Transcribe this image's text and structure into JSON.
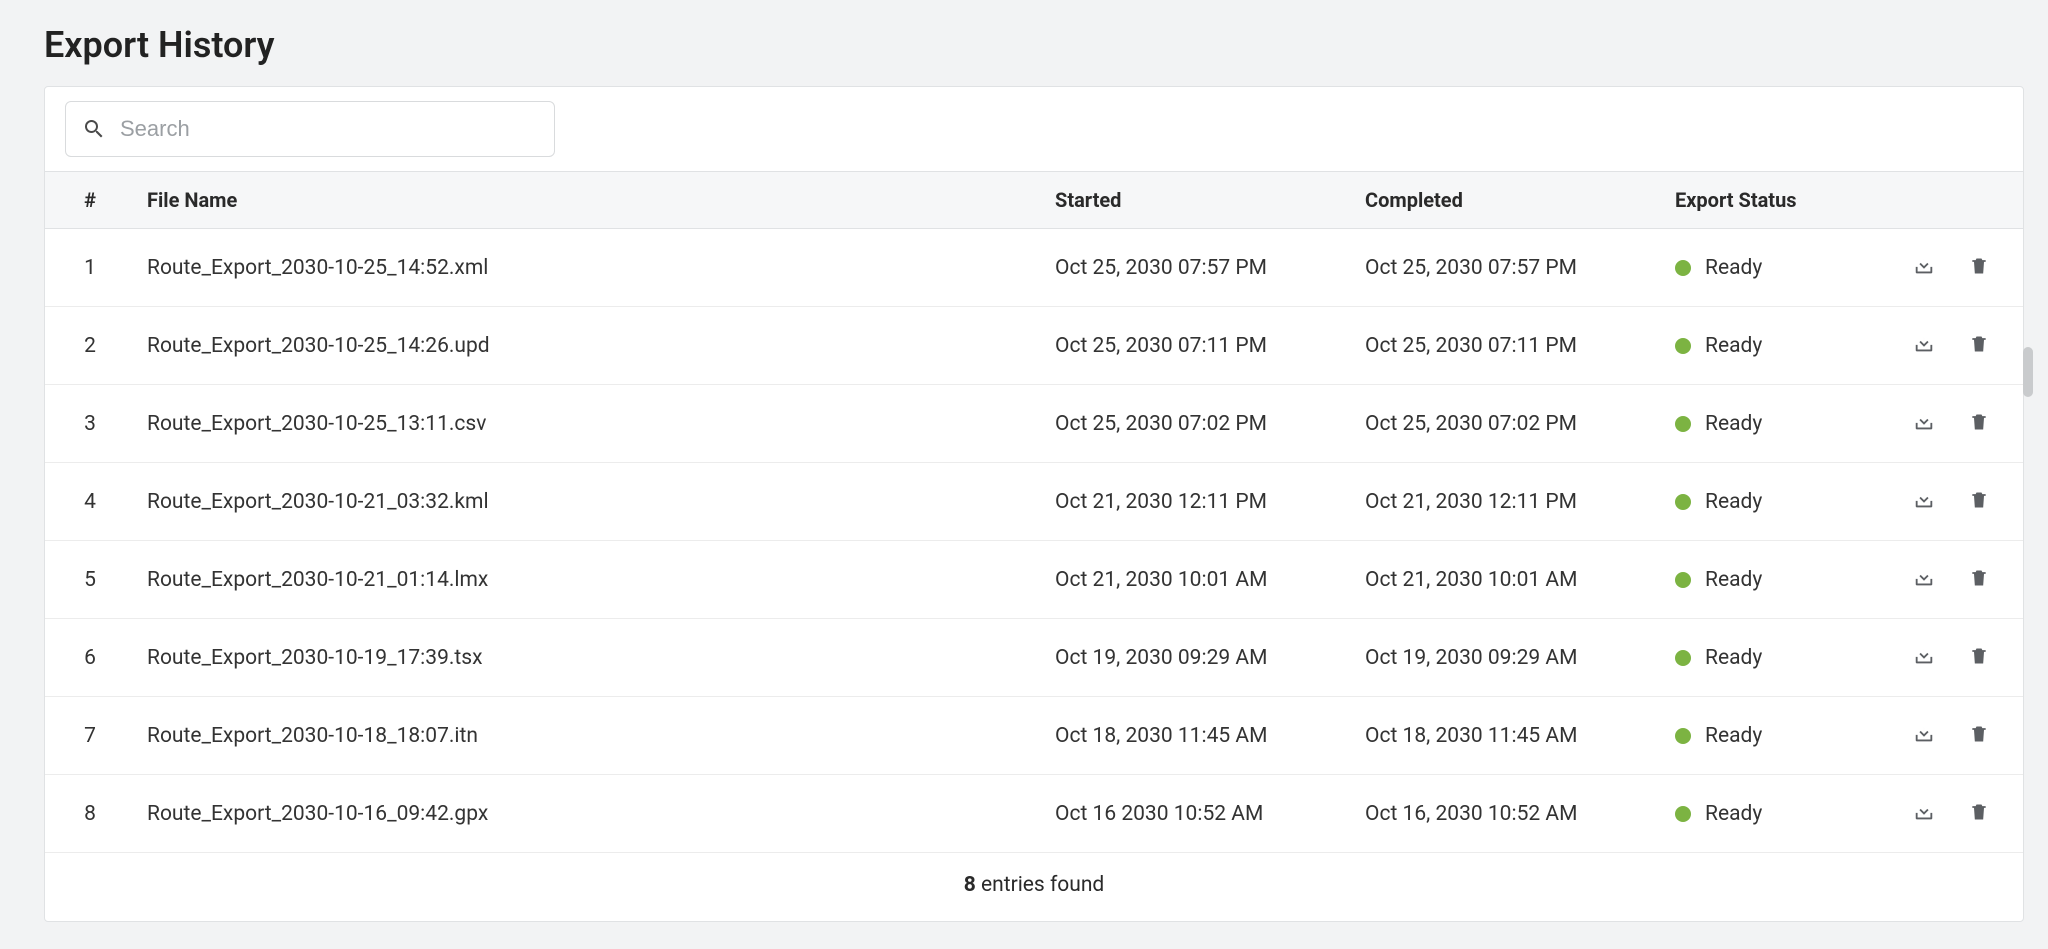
{
  "page": {
    "title": "Export History"
  },
  "search": {
    "placeholder": "Search"
  },
  "table": {
    "headers": {
      "num": "#",
      "file": "File Name",
      "started": "Started",
      "completed": "Completed",
      "status": "Export Status"
    },
    "rows": [
      {
        "num": "1",
        "file": "Route_Export_2030-10-25_14:52.xml",
        "started": "Oct 25, 2030 07:57 PM",
        "completed": "Oct 25, 2030 07:57 PM",
        "status": "Ready"
      },
      {
        "num": "2",
        "file": "Route_Export_2030-10-25_14:26.upd",
        "started": "Oct 25, 2030 07:11 PM",
        "completed": "Oct 25, 2030 07:11 PM",
        "status": "Ready"
      },
      {
        "num": "3",
        "file": "Route_Export_2030-10-25_13:11.csv",
        "started": "Oct 25, 2030 07:02 PM",
        "completed": "Oct 25, 2030 07:02 PM",
        "status": "Ready"
      },
      {
        "num": "4",
        "file": "Route_Export_2030-10-21_03:32.kml",
        "started": "Oct 21, 2030 12:11 PM",
        "completed": "Oct 21, 2030 12:11 PM",
        "status": "Ready"
      },
      {
        "num": "5",
        "file": "Route_Export_2030-10-21_01:14.lmx",
        "started": "Oct 21, 2030 10:01 AM",
        "completed": "Oct 21, 2030 10:01 AM",
        "status": "Ready"
      },
      {
        "num": "6",
        "file": "Route_Export_2030-10-19_17:39.tsx",
        "started": "Oct 19, 2030 09:29 AM",
        "completed": "Oct 19, 2030 09:29 AM",
        "status": "Ready"
      },
      {
        "num": "7",
        "file": "Route_Export_2030-10-18_18:07.itn",
        "started": "Oct 18, 2030 11:45 AM",
        "completed": "Oct 18, 2030 11:45 AM",
        "status": "Ready"
      },
      {
        "num": "8",
        "file": "Route_Export_2030-10-16_09:42.gpx",
        "started": "Oct 16 2030 10:52 AM",
        "completed": "Oct 16, 2030 10:52 AM",
        "status": "Ready"
      }
    ]
  },
  "footer": {
    "count": "8",
    "suffix": " entries found"
  },
  "status_color": "#7cb342"
}
